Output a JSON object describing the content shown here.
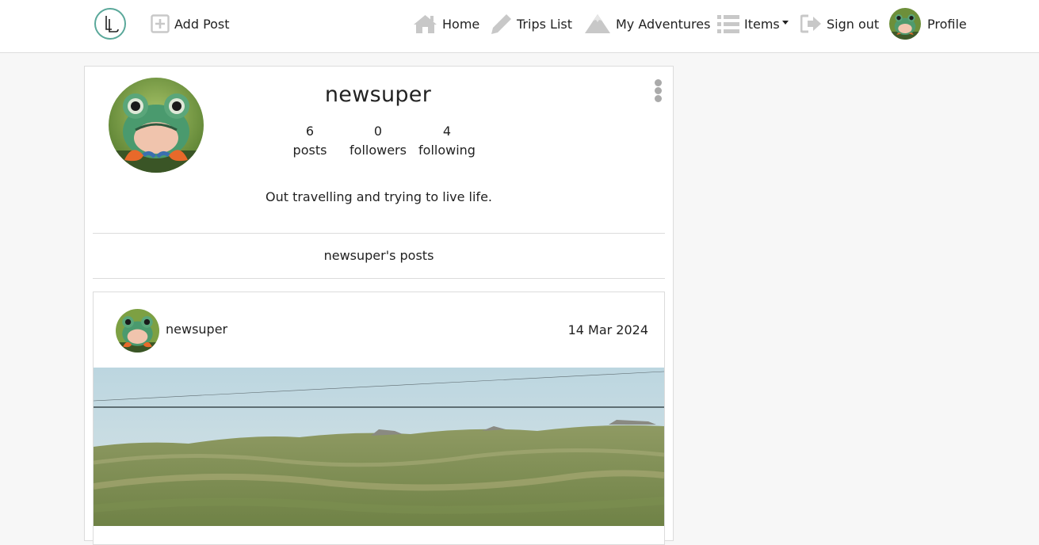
{
  "nav": {
    "add_post": "Add Post",
    "home": "Home",
    "trips_list": "Trips List",
    "my_adventures": "My Adventures",
    "items": "Items",
    "sign_out": "Sign out",
    "profile": "Profile",
    "icons": {
      "logo": "ll-logo",
      "add_post": "plus-square-icon",
      "home": "house-icon",
      "trips_list": "pencil-icon",
      "my_adventures": "mountain-icon",
      "items": "list-icon",
      "sign_out": "sign-out-icon"
    }
  },
  "profile": {
    "username": "newsuper",
    "posts_count": "6",
    "posts_label": "posts",
    "followers_count": "0",
    "followers_label": "followers",
    "following_count": "4",
    "following_label": "following",
    "bio": "Out travelling and trying to live life.",
    "posts_heading": "newsuper's posts"
  },
  "post": {
    "author": "newsuper",
    "date": "14 Mar 2024"
  },
  "colors": {
    "nav_icon": "#c8c8c8",
    "logo_ring": "#5aa89a",
    "background": "#f7f7f7"
  }
}
